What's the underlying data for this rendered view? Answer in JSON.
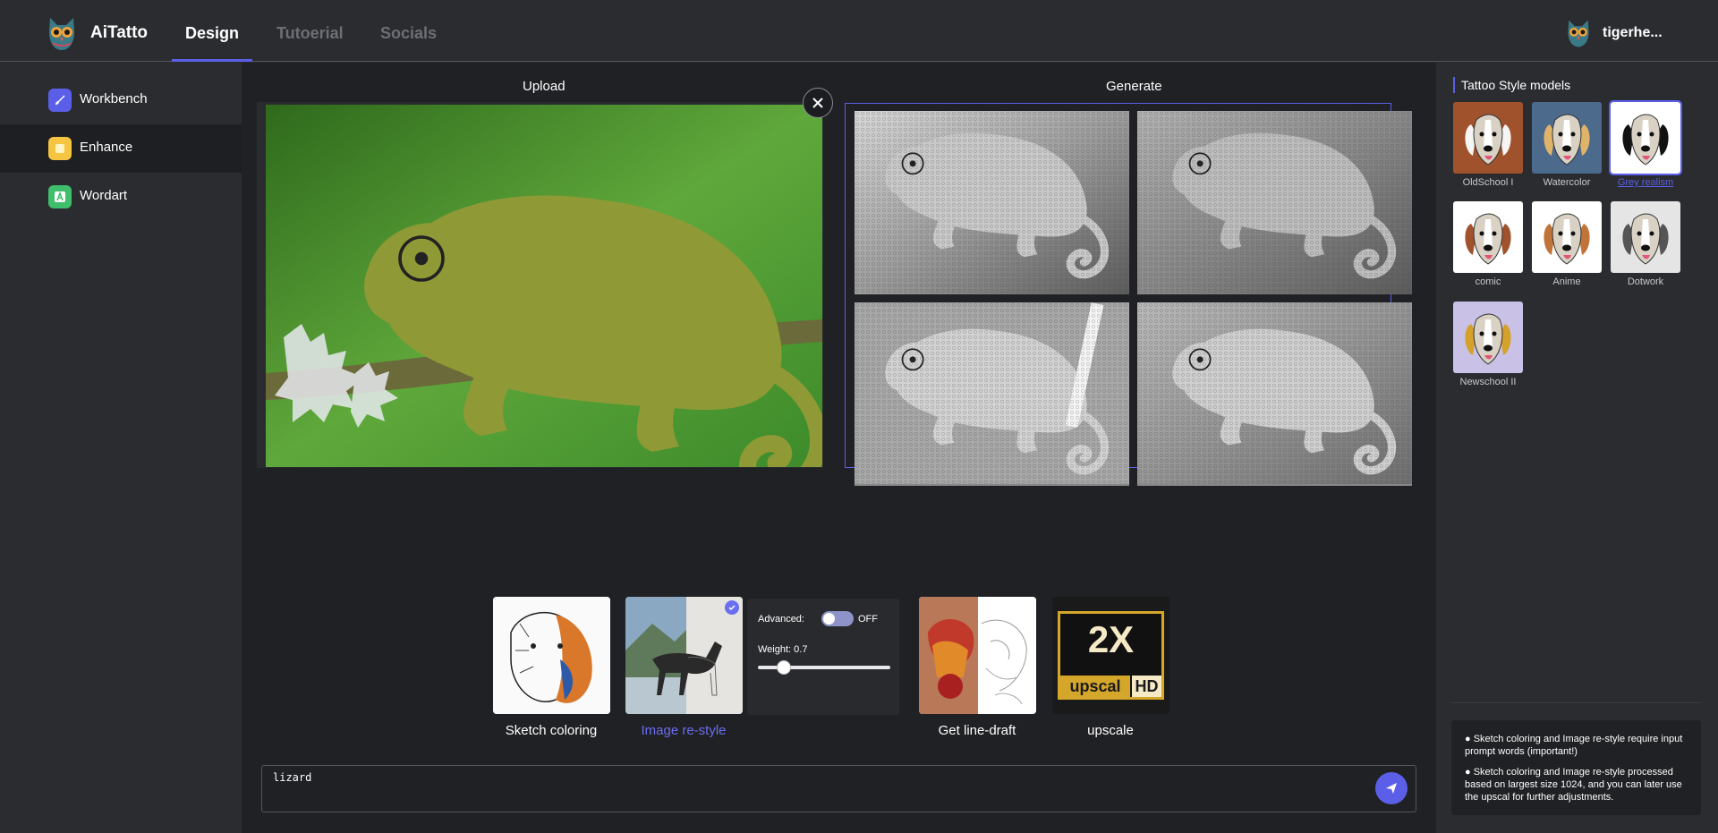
{
  "header": {
    "brand": "AiTatto",
    "tabs": [
      {
        "label": "Design",
        "active": true
      },
      {
        "label": "Tutoerial",
        "active": false
      },
      {
        "label": "Socials",
        "active": false
      }
    ],
    "username": "tigerhe..."
  },
  "sidebar": {
    "items": [
      {
        "label": "Workbench",
        "icon": "brush-icon",
        "color": "#5b5fe8"
      },
      {
        "label": "Enhance",
        "icon": "square-icon",
        "color": "#f5c542",
        "active": true
      },
      {
        "label": "Wordart",
        "icon": "letter-a-icon",
        "color": "#3fbf6c"
      }
    ]
  },
  "main": {
    "upload_title": "Upload",
    "generate_title": "Generate",
    "tools": [
      {
        "label": "Sketch coloring"
      },
      {
        "label": "Image re-style",
        "selected": true
      },
      {
        "label": "Get line-draft"
      },
      {
        "label": "upscale"
      }
    ],
    "advanced": {
      "label": "Advanced:",
      "toggle_text": "OFF",
      "weight_label": "Weight: 0.7",
      "weight_value": 0.7
    },
    "upscale_badge": {
      "big": "2X",
      "left": "upscal",
      "right": "HD"
    },
    "prompt_value": "lizard"
  },
  "right_panel": {
    "title": "Tattoo Style models",
    "styles": [
      {
        "label": "OldSchool I",
        "selected": false
      },
      {
        "label": "Watercolor",
        "selected": false
      },
      {
        "label": "Grey realism",
        "selected": true
      },
      {
        "label": "comic",
        "selected": false
      },
      {
        "label": "Anime",
        "selected": false
      },
      {
        "label": "Dotwork",
        "selected": false
      },
      {
        "label": "Newschool II",
        "selected": false
      }
    ],
    "notes": [
      "Sketch coloring and Image re-style require input prompt words  (important!)",
      "Sketch coloring and Image re-style processed based on largest size 1024, and you can later use the upscal for further adjustments."
    ]
  },
  "colors": {
    "accent": "#5b5fe8",
    "bg_dark": "#202124",
    "bg_panel": "#2b2c30"
  }
}
